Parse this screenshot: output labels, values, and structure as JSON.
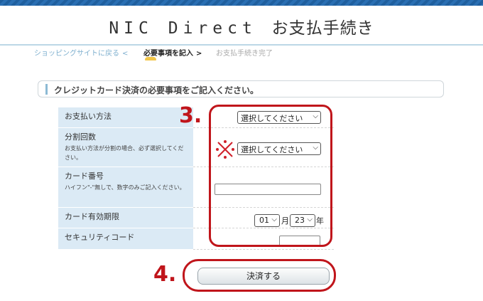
{
  "header": {
    "title_latin": "NIC Direct",
    "title_jp": "お支払手続き"
  },
  "breadcrumb": {
    "step1": "ショッピングサイトに戻る",
    "sep1": "<",
    "step2": "必要事項を記入",
    "sep2": ">",
    "step3": "お支払手続き完了"
  },
  "notice": "クレジットカード決済の必要事項をご記入ください。",
  "form": {
    "method": {
      "label": "お支払い方法",
      "selected": "選択してください"
    },
    "split": {
      "label": "分割回数",
      "note": "お支払い方法が分割の場合、必ず選択してください。",
      "selected": "選択してください"
    },
    "card": {
      "label": "カード番号",
      "note": "ハイフン\"-\"無しで、数字のみご記入ください。",
      "value": ""
    },
    "expiry": {
      "label": "カード有効期限",
      "month": "01",
      "month_unit": "月",
      "day": "23",
      "year_unit": "年"
    },
    "cvc": {
      "label": "セキュリティコード",
      "value": ""
    }
  },
  "submit_label": "決済する",
  "annotations": {
    "step3": "3.",
    "step4": "4."
  },
  "colors": {
    "annotation_red": "#c0151b",
    "label_bg": "#dbeaf5",
    "top_stripe": "#1f5f9e"
  }
}
